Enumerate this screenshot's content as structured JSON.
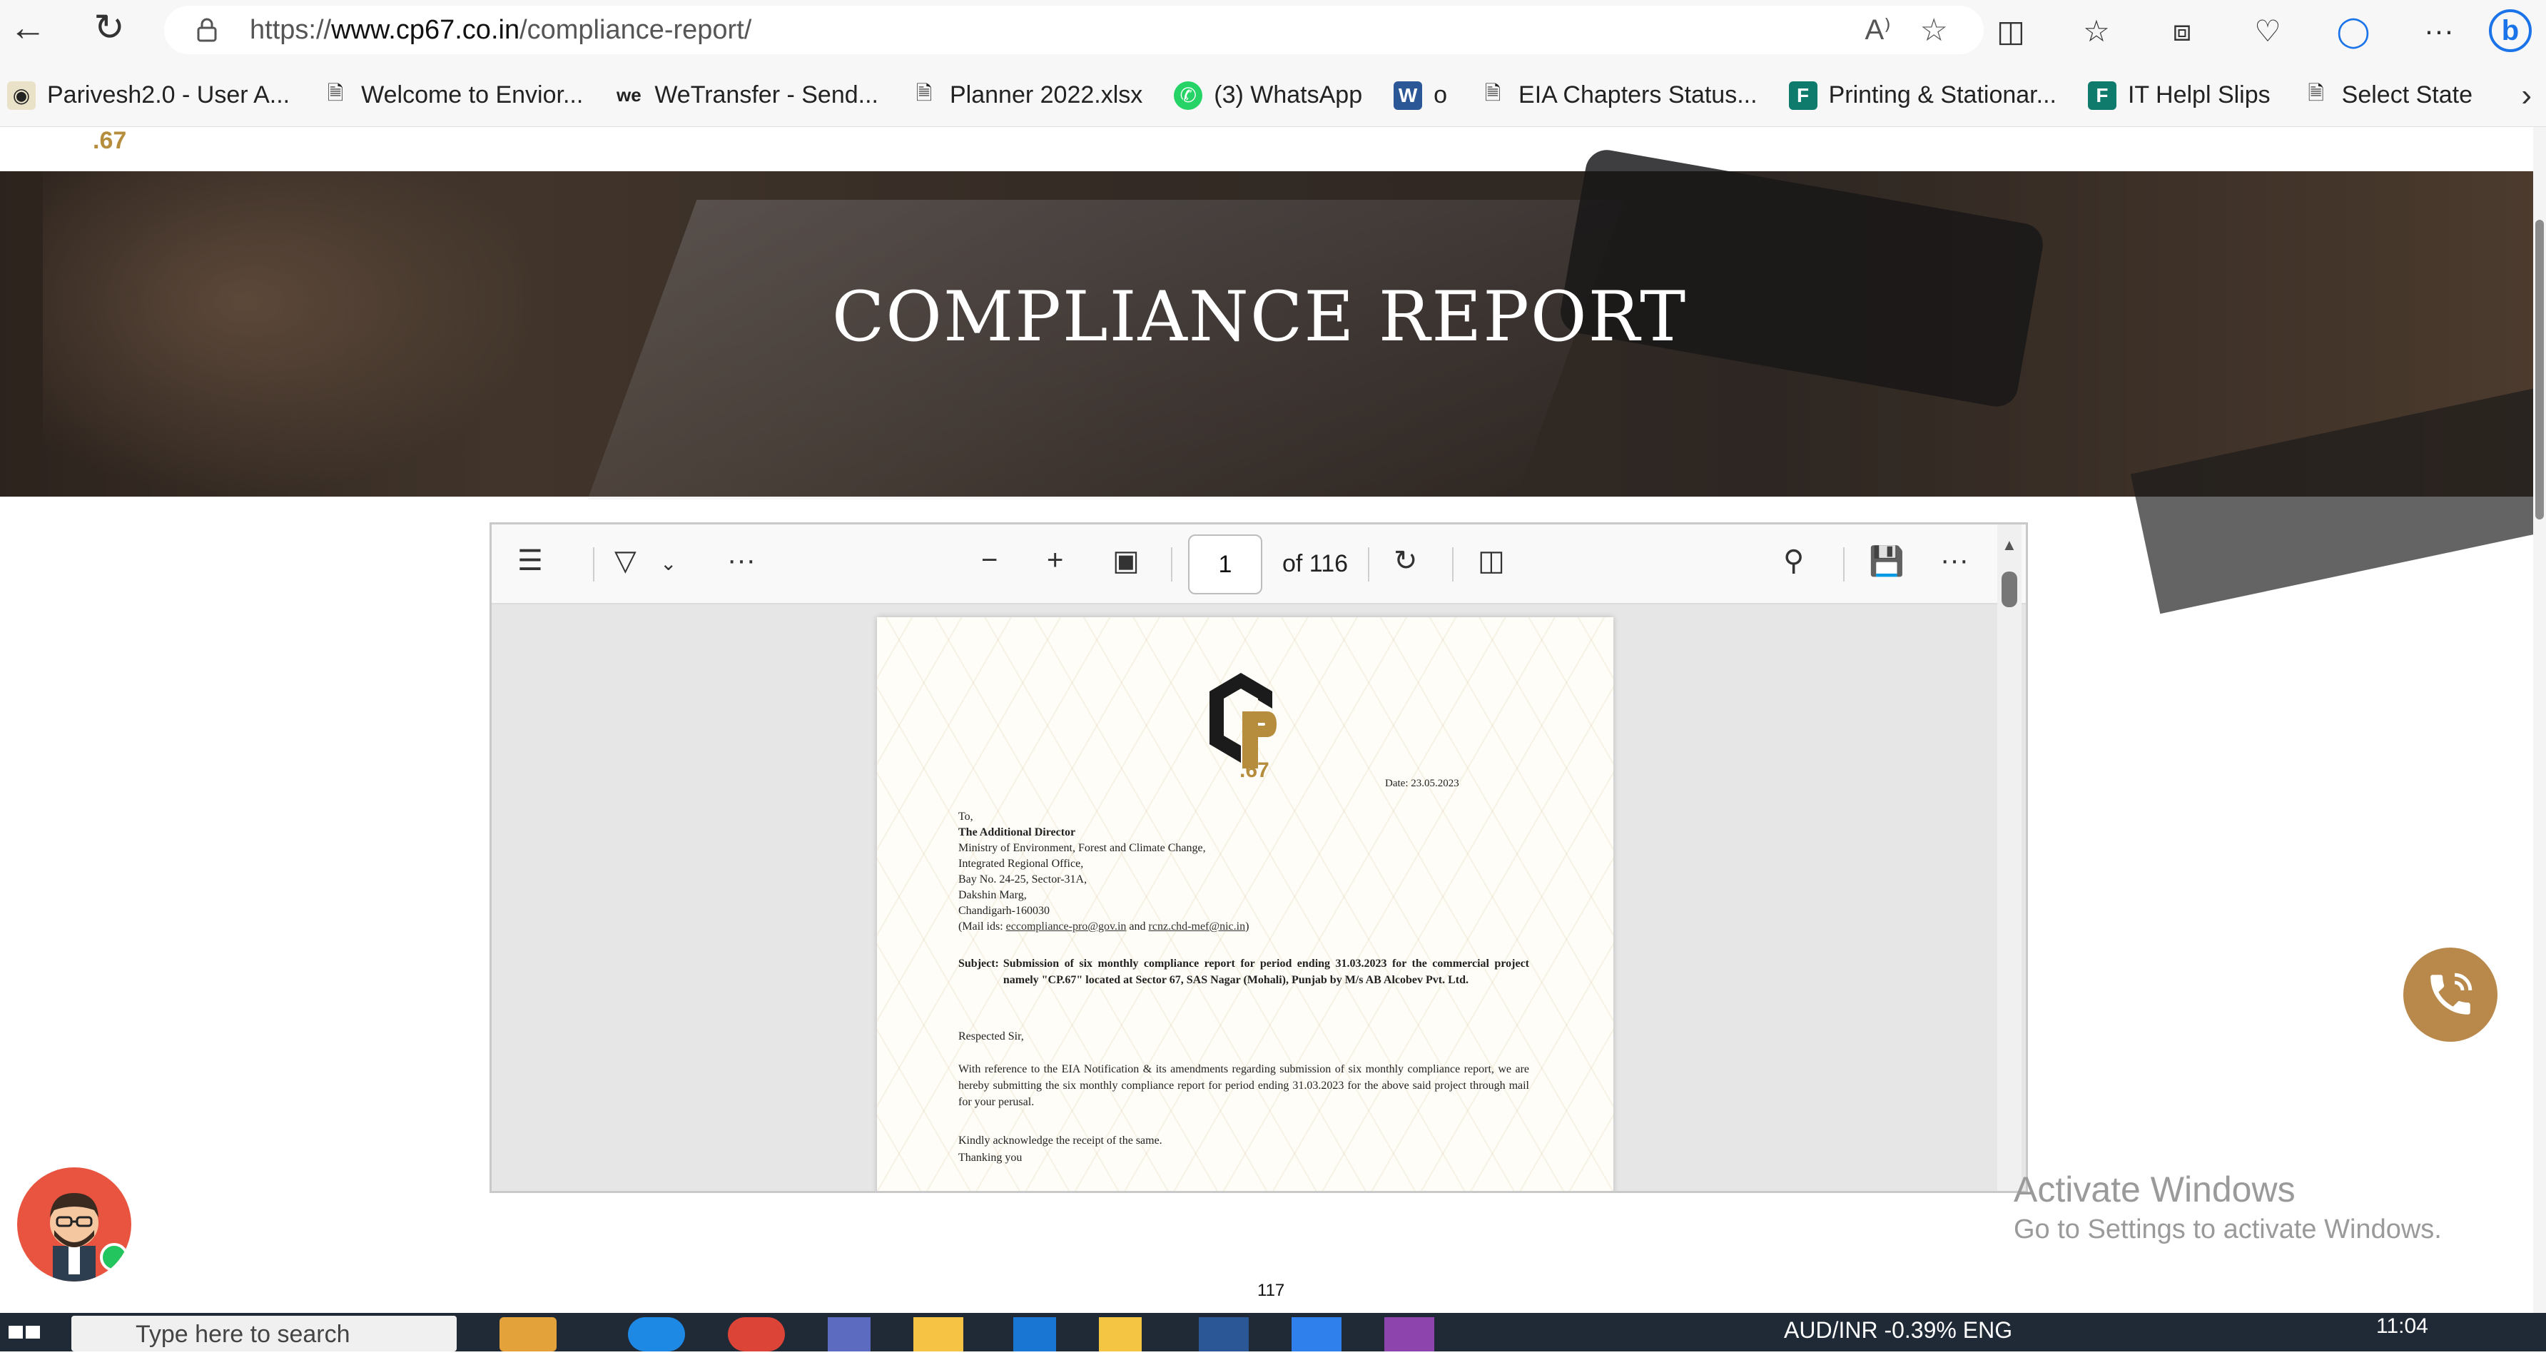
{
  "browser": {
    "url_host": "https://www.cp67.co.in",
    "url_path": "/compliance-report/",
    "url_prefix": "https://",
    "url_domain": "www.cp67.co.in",
    "read_aloud_label": "Aᴬ",
    "more_label": "···"
  },
  "bookmarks": [
    {
      "label": "Parivesh2.0 - User A..."
    },
    {
      "label": "Welcome to Envior..."
    },
    {
      "label": "WeTransfer - Send..."
    },
    {
      "label": "Planner 2022.xlsx"
    },
    {
      "label": "(3) WhatsApp"
    },
    {
      "label": "o"
    },
    {
      "label": "EIA Chapters Status..."
    },
    {
      "label": "Printing & Stationar..."
    },
    {
      "label": "IT Helpl Slips"
    },
    {
      "label": "Select State"
    }
  ],
  "site": {
    "brand_partial": ".67",
    "hero_title": "COMPLIANCE REPORT"
  },
  "pdf": {
    "current_page": "1",
    "of_pages": "of 116",
    "letter": {
      "logo_num": ".67",
      "date": "Date: 23.05.2023",
      "to": "To,",
      "addressee": "The Additional Director",
      "address_lines": [
        "Ministry of Environment, Forest and Climate Change,",
        "Integrated Regional Office,",
        "Bay No. 24-25, Sector-31A,",
        "Dakshin Marg,",
        "Chandigarh-160030"
      ],
      "mail_prefix": "(Mail ids: ",
      "mail_1": "eccompliance-pro@gov.in",
      "mail_and": " and ",
      "mail_2": "rcnz.chd-mef@nic.in",
      "mail_suffix": ")",
      "subject_label": "Subject:",
      "subject_text": "Submission of six monthly compliance report for period ending 31.03.2023 for the commercial project namely \"CP.67\" located at Sector 67, SAS Nagar (Mohali), Punjab by M/s AB Alcobev Pvt. Ltd.",
      "salutation": "Respected Sir,",
      "body": "With reference to the EIA Notification & its amendments regarding submission of six monthly compliance report, we are hereby submitting the six monthly compliance report for period ending 31.03.2023 for the above said project through mail for your perusal.",
      "ack": "Kindly acknowledge the receipt of the same.",
      "thanks": "Thanking you"
    },
    "page_footer_number": "117"
  },
  "watermark": {
    "line1": "Activate Windows",
    "line2": "Go to Settings to activate Windows."
  },
  "taskbar": {
    "search_placeholder": "Type here to search",
    "tray_text": "AUD/INR   -0.39%      ENG",
    "time": "11:04"
  },
  "colors": {
    "brand_gold": "#b8894b",
    "avatar_bg": "#e8543f",
    "online_green": "#22c55e"
  }
}
